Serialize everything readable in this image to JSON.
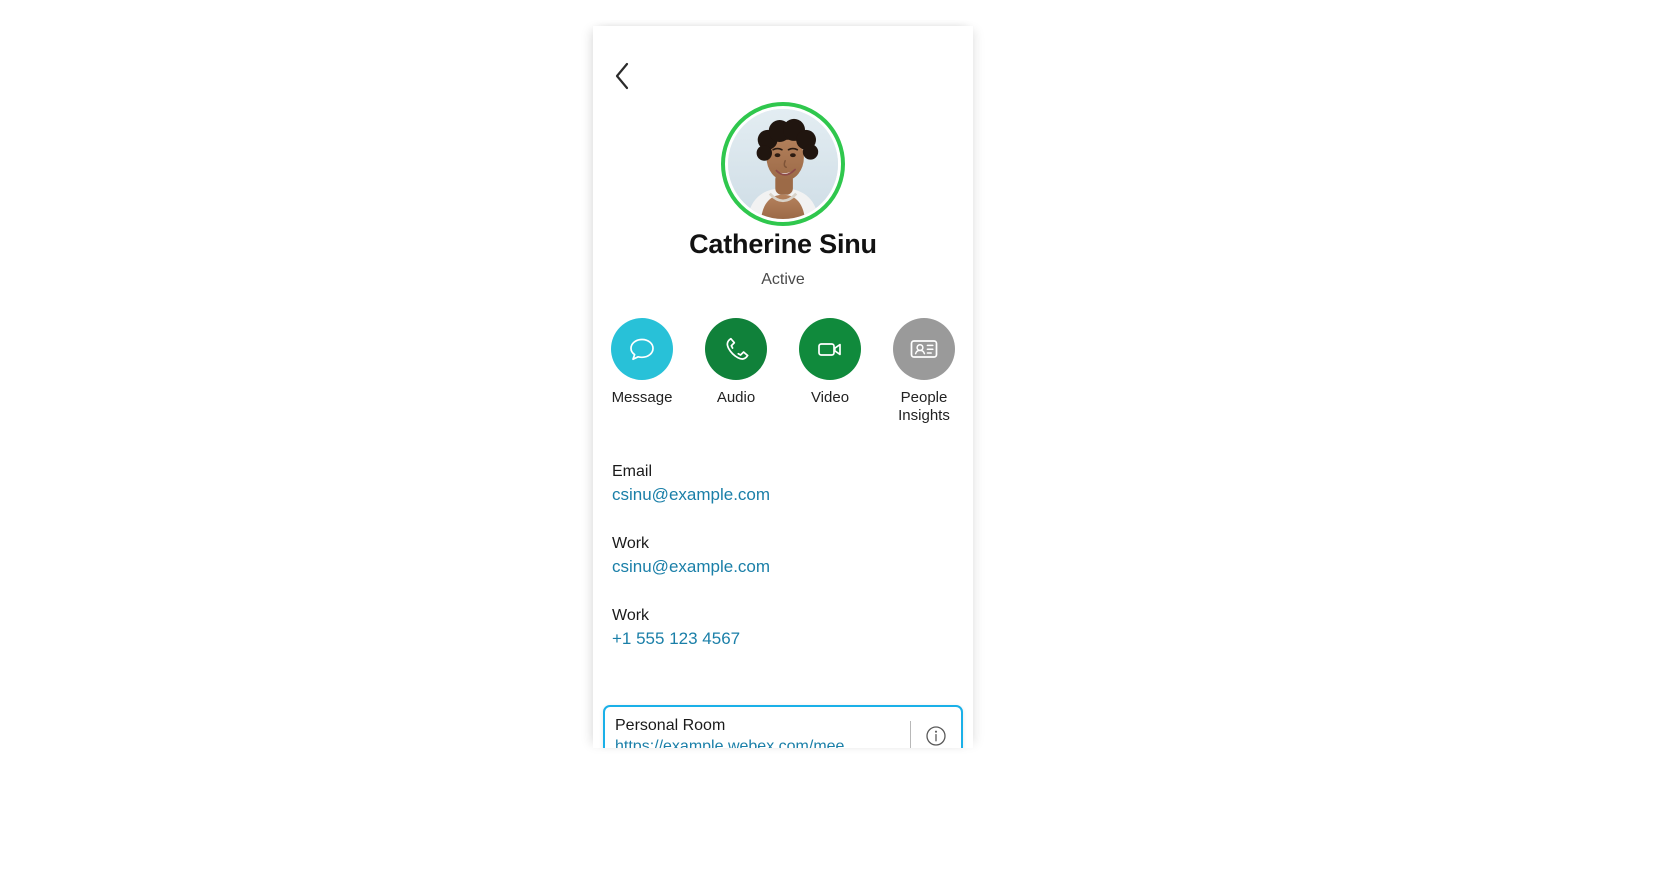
{
  "panel": {
    "back_button_icon": "chevron-left-icon"
  },
  "profile": {
    "name": "Catherine Sinu",
    "presence": "Active",
    "presence_ring_color": "#2fc74d",
    "avatar_icon": "user-photo-avatar"
  },
  "actions": [
    {
      "label": "Message",
      "icon": "message-bubble-icon",
      "color": "#28c1d8"
    },
    {
      "label": "Audio",
      "icon": "phone-handset-icon",
      "color": "#10813a"
    },
    {
      "label": "Video",
      "icon": "video-camera-icon",
      "color": "#108a3c"
    },
    {
      "label": "People Insights",
      "icon": "id-card-icon",
      "color": "#9a9a9a"
    }
  ],
  "details": [
    {
      "label": "Email",
      "value": "csinu@example.com"
    },
    {
      "label": "Work",
      "value": "csinu@example.com"
    },
    {
      "label": "Work",
      "value": "+1 555 123 4567"
    }
  ],
  "personal_room": {
    "label": "Personal Room",
    "url": "https://example.webex.com/mee..",
    "info_icon": "info-circle-icon",
    "focus_color": "#1ab0e8"
  },
  "colors": {
    "link": "#1a7fa8",
    "text": "#1a1a1a",
    "page_background": "#ffffff"
  }
}
